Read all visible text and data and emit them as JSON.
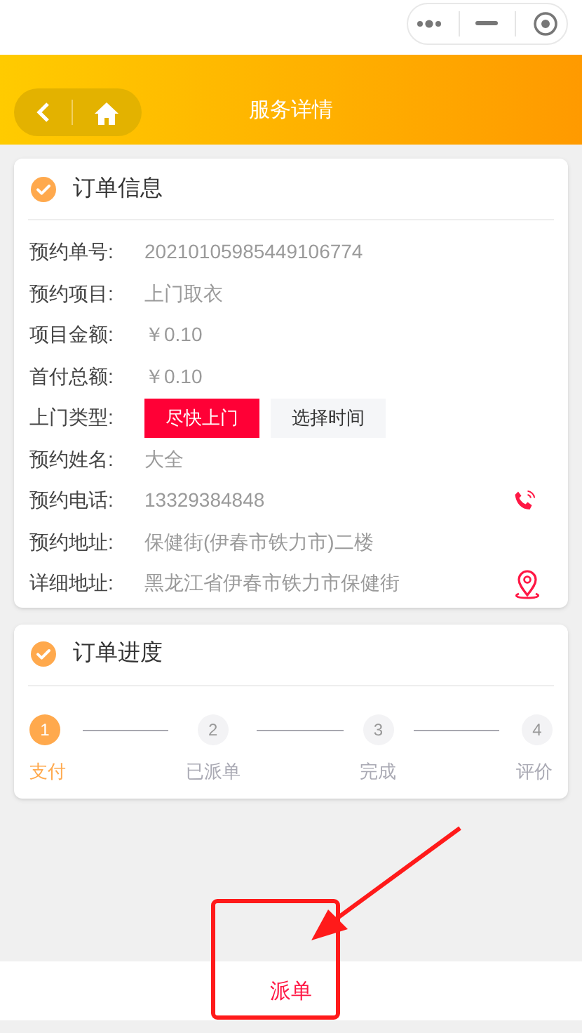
{
  "header": {
    "title": "服务详情"
  },
  "order_card": {
    "title": "订单信息",
    "rows": [
      {
        "kind": "text",
        "label": "预约单号:",
        "value": "20210105985449106774"
      },
      {
        "kind": "text",
        "label": "预约项目:",
        "value": "上门取衣"
      },
      {
        "kind": "text",
        "label": "项目金额:",
        "value": "￥0.10"
      },
      {
        "kind": "text",
        "label": "首付总额:",
        "value": "￥0.10"
      },
      {
        "kind": "choice",
        "label": "上门类型:",
        "options": [
          {
            "label": "尽快上门",
            "selected": true
          },
          {
            "label": "选择时间",
            "selected": false
          }
        ]
      },
      {
        "kind": "text",
        "label": "预约姓名:",
        "value": "大全"
      },
      {
        "kind": "phone",
        "label": "预约电话:",
        "value": "13329384848"
      },
      {
        "kind": "text",
        "label": "预约地址:",
        "value": "保健街(伊春市铁力市)二楼"
      },
      {
        "kind": "location",
        "label": "详细地址:",
        "value": "黑龙江省伊春市铁力市保健街"
      }
    ]
  },
  "progress_card": {
    "title": "订单进度",
    "steps": [
      {
        "number": "1",
        "label": "支付",
        "active": true
      },
      {
        "number": "2",
        "label": "已派单",
        "active": false
      },
      {
        "number": "3",
        "label": "完成",
        "active": false
      },
      {
        "number": "4",
        "label": "评价",
        "active": false
      }
    ]
  },
  "bottom_button": "派单"
}
